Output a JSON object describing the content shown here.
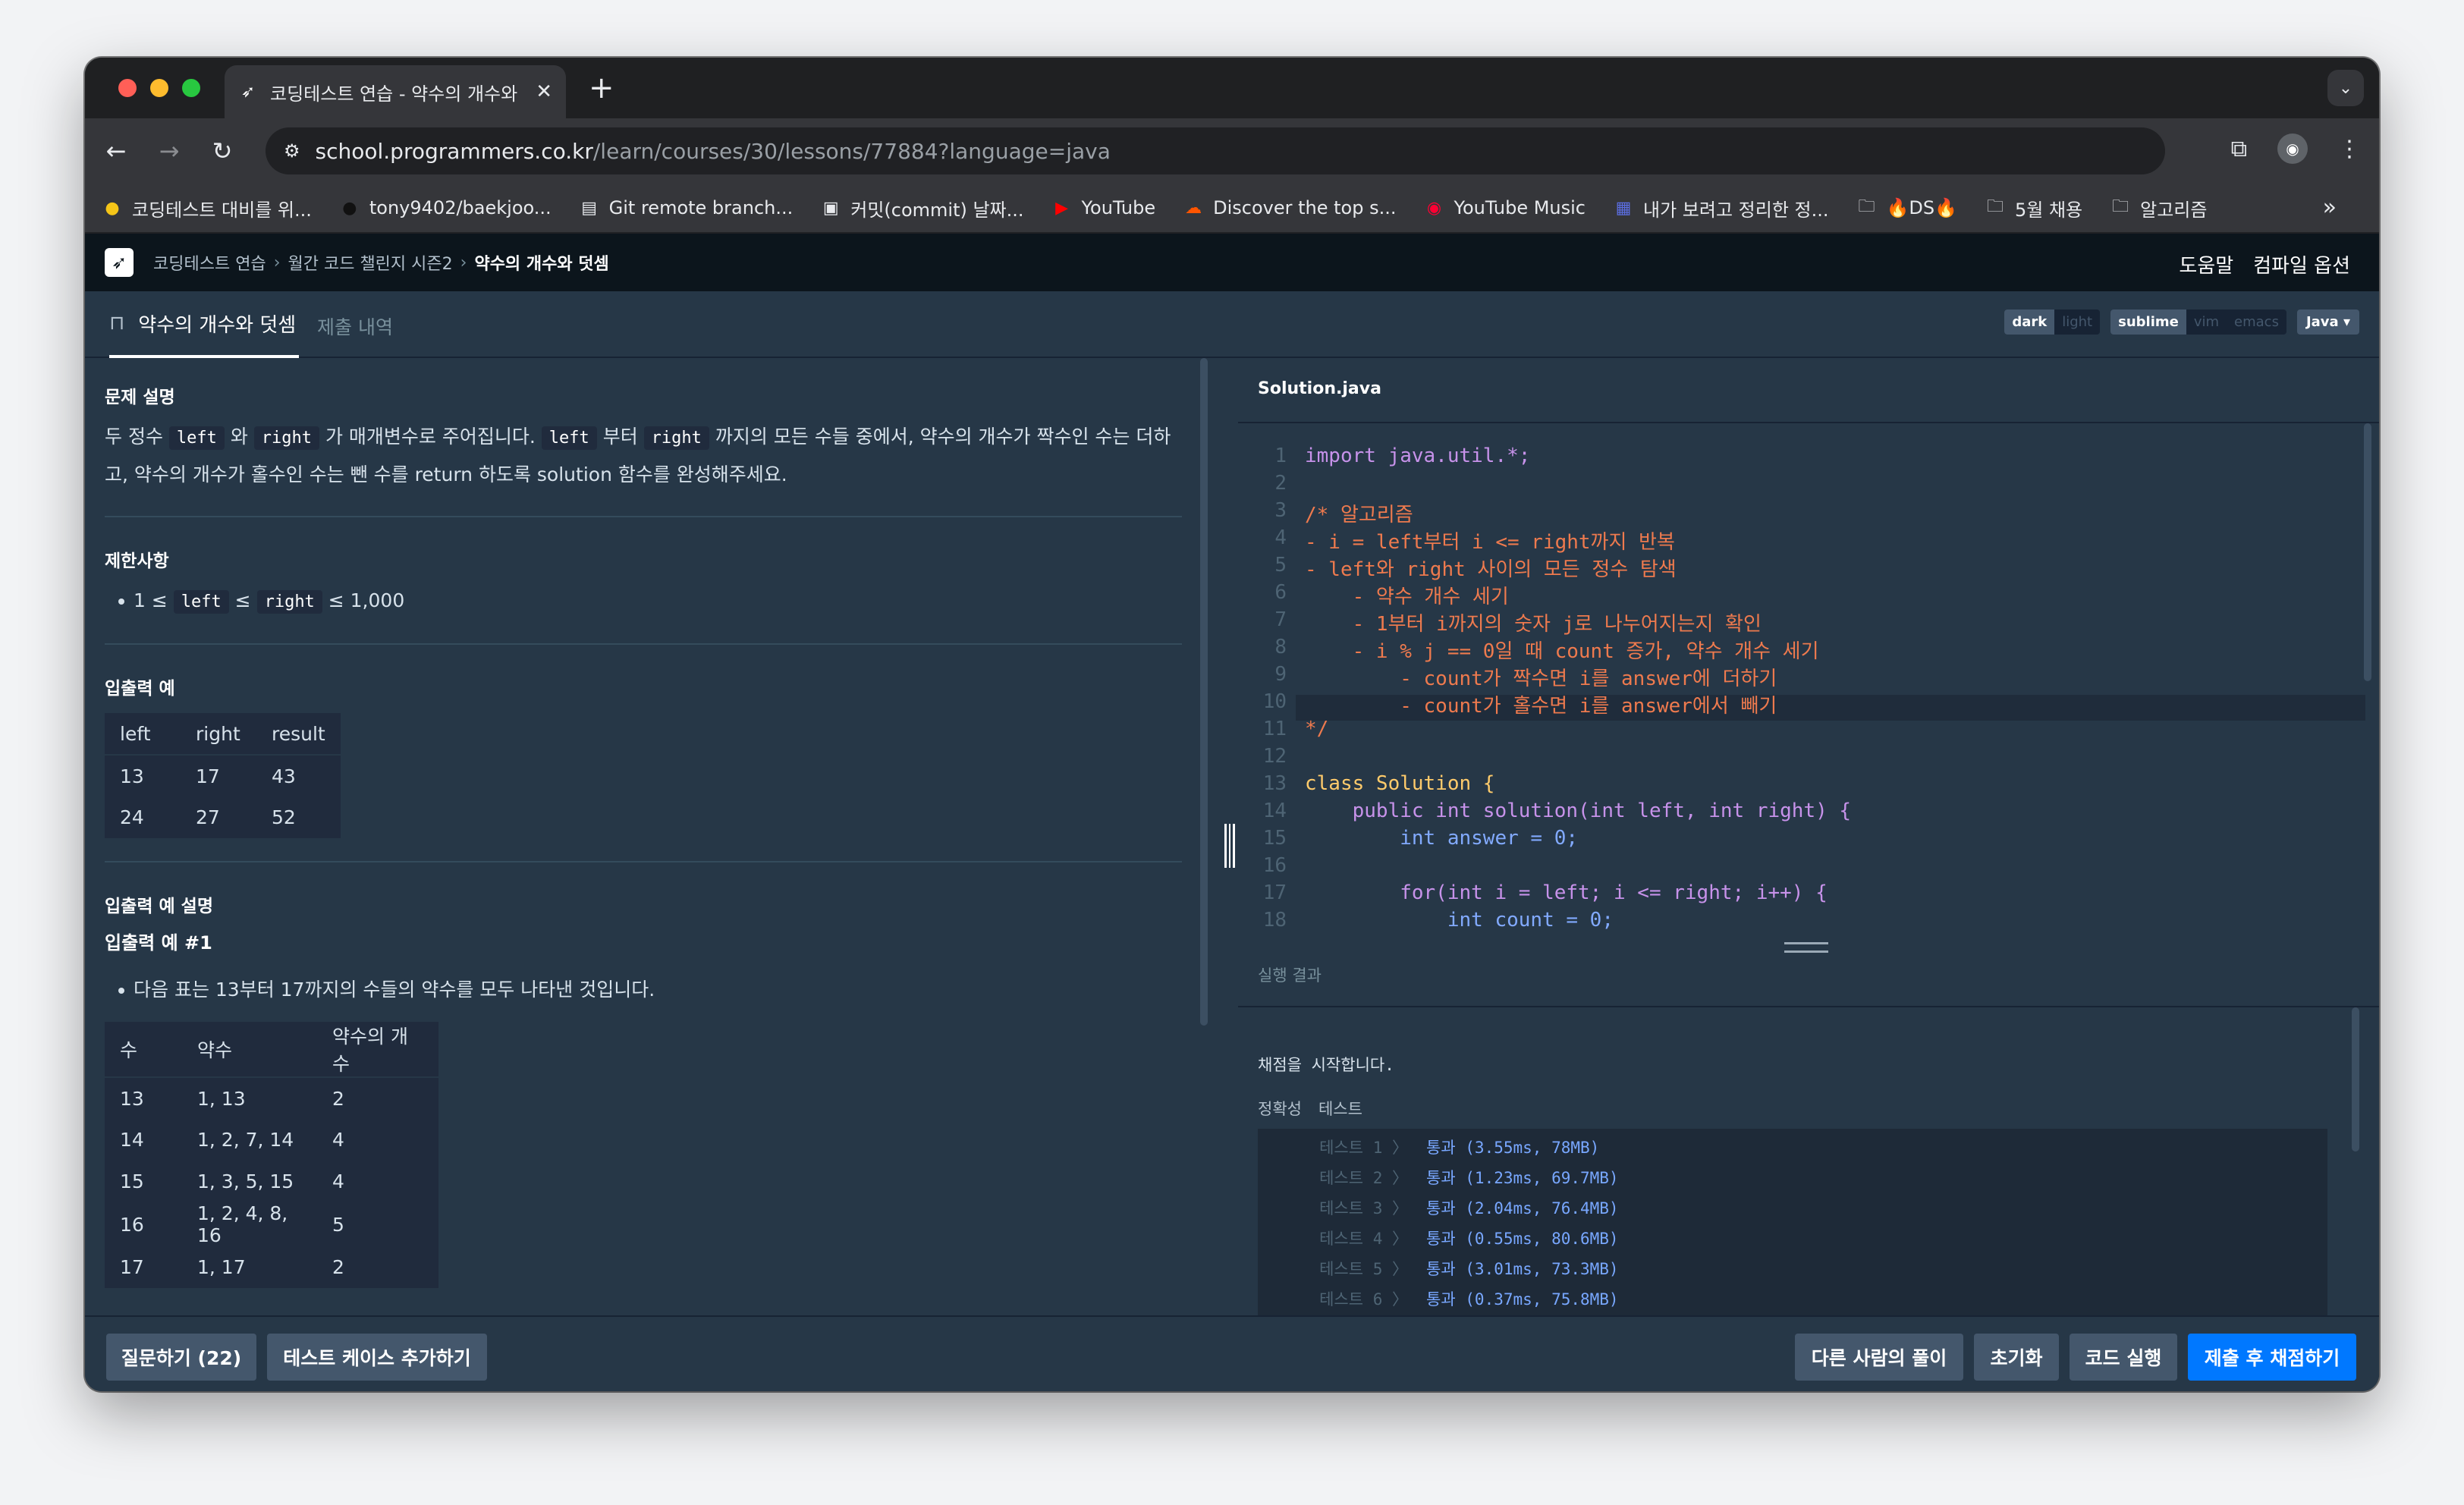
{
  "browser": {
    "tab_title": "코딩테스트 연습 - 약수의 개수와 덧셈 | 프로그래머스 스쿨",
    "url_host": "school.programmers.co.kr",
    "url_path": "/learn/courses/30/lessons/77884?language=java"
  },
  "bookmarks": [
    {
      "label": "코딩테스트 대비를 위...",
      "icon": "circle-yellow-icon"
    },
    {
      "label": "tony9402/baekjoo...",
      "icon": "github-icon"
    },
    {
      "label": "Git remote branch...",
      "icon": "page-icon"
    },
    {
      "label": "커밋(commit) 날짜...",
      "icon": "page-icon"
    },
    {
      "label": "YouTube",
      "icon": "youtube-icon"
    },
    {
      "label": "Discover the top s...",
      "icon": "soundcloud-icon"
    },
    {
      "label": "YouTube Music",
      "icon": "youtube-music-icon"
    },
    {
      "label": "내가 보려고 정리한 정...",
      "icon": "page-icon"
    },
    {
      "label": "🔥DS🔥",
      "icon": "folder-icon"
    },
    {
      "label": "5월 채용",
      "icon": "folder-icon"
    },
    {
      "label": "알고리즘",
      "icon": "folder-icon"
    }
  ],
  "header": {
    "breadcrumb": [
      "코딩테스트 연습",
      "월간 코드 챌린지 시즌2",
      "약수의 개수와 덧셈"
    ],
    "help": "도움말",
    "compile_options": "컴파일 옵션"
  },
  "lesson_tabs": {
    "problem": "약수의 개수와 덧셈",
    "submissions": "제출 내역"
  },
  "editor_options": {
    "themes": [
      "dark",
      "light"
    ],
    "keymaps": [
      "sublime",
      "vim",
      "emacs"
    ],
    "language": "Java"
  },
  "problem": {
    "desc_title": "문제 설명",
    "desc": {
      "a": "두 정수 ",
      "left": "left",
      "b": " 와 ",
      "right": "right",
      "c": " 가 매개변수로 주어집니다. ",
      "d": " 부터 ",
      "e": " 까지의 모든 수들 중에서, 약수의 개수가 짝수인 수는 더하",
      "f": "고, 약수의 개수가 홀수인 수는 뺀 수를 return 하도록 solution 함수를 완성해주세요."
    },
    "constraints_title": "제한사항",
    "constraint": {
      "a": "1 ≤ ",
      "left": "left",
      "b": " ≤ ",
      "right": "right",
      "c": " ≤ 1,000"
    },
    "io_title": "입출력 예",
    "io_headers": [
      "left",
      "right",
      "result"
    ],
    "io_rows": [
      [
        "13",
        "17",
        "43"
      ],
      [
        "24",
        "27",
        "52"
      ]
    ],
    "io_explain_title": "입출력 예 설명",
    "io_ex1_title": "입출력 예 #1",
    "io_ex1_bullet": "다음 표는 13부터 17까지의 수들의 약수를 모두 나타낸 것입니다.",
    "div_headers": [
      "수",
      "약수",
      "약수의 개수"
    ],
    "div_rows": [
      [
        "13",
        "1, 13",
        "2"
      ],
      [
        "14",
        "1, 2, 7, 14",
        "4"
      ],
      [
        "15",
        "1, 3, 5, 15",
        "4"
      ],
      [
        "16",
        "1, 2, 4, 8, 16",
        "5"
      ],
      [
        "17",
        "1, 17",
        "2"
      ]
    ]
  },
  "file_name": "Solution.java",
  "code_lines": [
    "import java.util.*;",
    "",
    "/* 알고리즘",
    "- i = left부터 i <= right까지 반복",
    "- left와 right 사이의 모든 정수 탐색",
    "    - 약수 개수 세기",
    "    - 1부터 i까지의 숫자 j로 나누어지는지 확인",
    "    - i % j == 0일 때 count 증가, 약수 개수 세기",
    "        - count가 짝수면 i를 answer에 더하기",
    "        - count가 홀수면 i를 answer에서 빼기",
    "*/",
    "",
    "class Solution {",
    "    public int solution(int left, int right) {",
    "        int answer = 0;",
    "",
    "        for(int i = left; i <= right; i++) {",
    "            int count = 0;"
  ],
  "line_numbers": [
    "1",
    "2",
    "3",
    "4",
    "5",
    "6",
    "7",
    "8",
    "9",
    "10",
    "11",
    "12",
    "13",
    "14",
    "15",
    "16",
    "17",
    "18"
  ],
  "results": {
    "title": "실행 결과",
    "start": "채점을 시작합니다.",
    "categories": [
      "정확성",
      "테스트"
    ],
    "tests": [
      {
        "name": "테스트 1 〉",
        "result": "통과 (3.55ms, 78MB)"
      },
      {
        "name": "테스트 2 〉",
        "result": "통과 (1.23ms, 69.7MB)"
      },
      {
        "name": "테스트 3 〉",
        "result": "통과 (2.04ms, 76.4MB)"
      },
      {
        "name": "테스트 4 〉",
        "result": "통과 (0.55ms, 80.6MB)"
      },
      {
        "name": "테스트 5 〉",
        "result": "통과 (3.01ms, 73.3MB)"
      },
      {
        "name": "테스트 6 〉",
        "result": "통과 (0.37ms, 75.8MB)"
      }
    ]
  },
  "footer": {
    "ask": "질문하기 (22)",
    "add_test": "테스트 케이스 추가하기",
    "others": "다른 사람의 풀이",
    "reset": "초기화",
    "run": "코드 실행",
    "submit": "제출 후 채점하기"
  },
  "colors": {
    "accent": "#0078ff",
    "page_bg": "#263747",
    "header_bg": "#0c151c"
  }
}
